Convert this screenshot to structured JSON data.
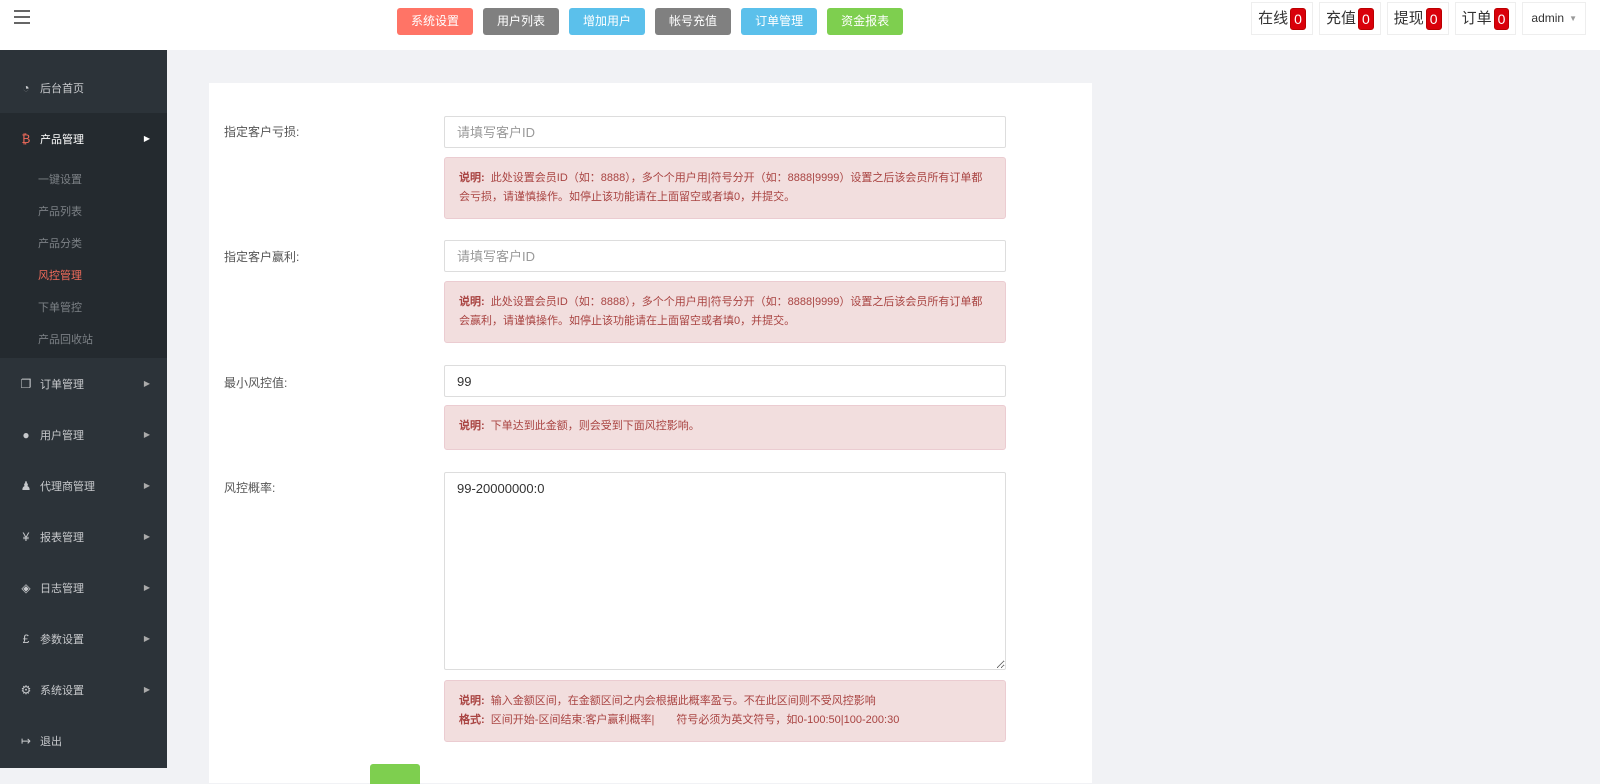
{
  "top_nav": [
    {
      "label": "系统设置",
      "color": "#ff7466"
    },
    {
      "label": "用户列表",
      "color": "#808080"
    },
    {
      "label": "增加用户",
      "color": "#5bc0eb"
    },
    {
      "label": "帐号充值",
      "color": "#808080"
    },
    {
      "label": "订单管理",
      "color": "#5bc0eb"
    },
    {
      "label": "资金报表",
      "color": "#7ecf4f"
    }
  ],
  "stats": [
    {
      "label": "在线",
      "count": "0"
    },
    {
      "label": "充值",
      "count": "0"
    },
    {
      "label": "提现",
      "count": "0"
    },
    {
      "label": "订单",
      "count": "0"
    }
  ],
  "user_menu": {
    "label": "admin",
    "caret": "▼"
  },
  "sidebar": {
    "home": {
      "icon": "◔",
      "label": "后台首页"
    },
    "product": {
      "icon": "₿",
      "label": "产品管理",
      "arrow": "▶",
      "children": [
        "一键设置",
        "产品列表",
        "产品分类",
        "风控管理",
        "下单管控",
        "产品回收站"
      ]
    },
    "rest": [
      {
        "icon": "❐",
        "label": "订单管理",
        "arrow": "▶"
      },
      {
        "icon": "●",
        "label": "用户管理",
        "arrow": "▶"
      },
      {
        "icon": "♟",
        "label": "代理商管理",
        "arrow": "▶"
      },
      {
        "icon": "¥",
        "label": "报表管理",
        "arrow": "▶"
      },
      {
        "icon": "◈",
        "label": "日志管理",
        "arrow": "▶"
      },
      {
        "icon": "£",
        "label": "参数设置",
        "arrow": "▶"
      },
      {
        "icon": "⚙",
        "label": "系统设置",
        "arrow": "▶"
      },
      {
        "icon": "↦",
        "label": "退出"
      }
    ]
  },
  "form": {
    "loss": {
      "label": "指定客户亏损:",
      "placeholder": "请填写客户ID",
      "note_title": "说明:",
      "note_text": "此处设置会员ID（如：8888），多个个用户用|符号分开（如：8888|9999）设置之后该会员所有订单都会亏损，请谨慎操作。如停止该功能请在上面留空或者填0，并提交。"
    },
    "profit": {
      "label": "指定客户赢利:",
      "placeholder": "请填写客户ID",
      "note_title": "说明:",
      "note_text": "此处设置会员ID（如：8888），多个个用户用|符号分开（如：8888|9999）设置之后该会员所有订单都会赢利，请谨慎操作。如停止该功能请在上面留空或者填0，并提交。"
    },
    "min_value": {
      "label": "最小风控值:",
      "value": "99",
      "note_title": "说明:",
      "note_text": "下单达到此金额，则会受到下面风控影响。"
    },
    "probability": {
      "label": "风控概率:",
      "value": "99-20000000:0",
      "note_title": "说明:",
      "note_text": "输入金额区间，在金额区间之内会根据此概率盈亏。不在此区间则不受风控影响",
      "format_title": "格式:",
      "format_text": "区间开始-区间结束:客户赢利概率|　　符号必须为英文符号，如0-100:50|100-200:30"
    }
  }
}
